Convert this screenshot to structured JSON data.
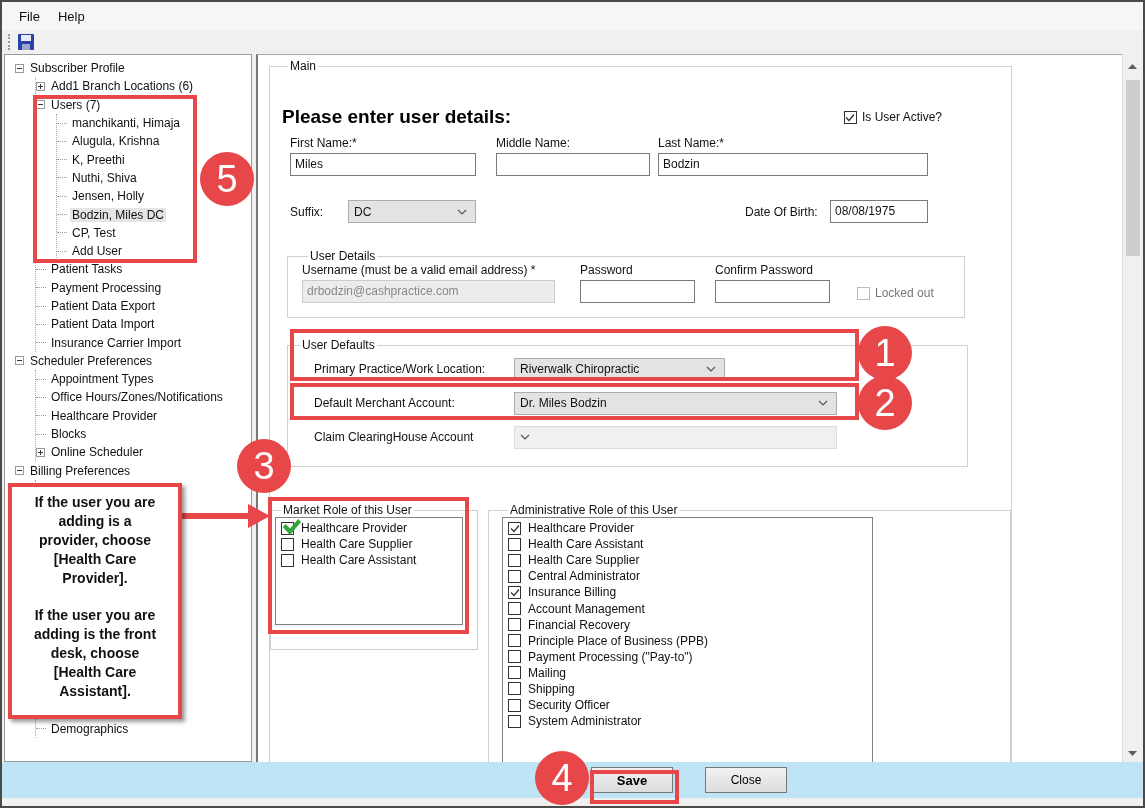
{
  "menu": [
    "File",
    "Help"
  ],
  "tree": [
    {
      "label": "Subscriber Profile",
      "expanded": true,
      "selected": false,
      "children": [
        {
          "label": "Add1 Branch Locations (6)",
          "expanded": false,
          "selected": false
        },
        {
          "label": "Users (7)",
          "expanded": true,
          "selected": false,
          "children": [
            {
              "label": "manchikanti, Himaja",
              "selected": false
            },
            {
              "label": "Alugula, Krishna",
              "selected": false
            },
            {
              "label": "K, Preethi",
              "selected": false
            },
            {
              "label": "Nuthi, Shiva",
              "selected": false
            },
            {
              "label": "Jensen, Holly",
              "selected": false
            },
            {
              "label": "Bodzin, Miles DC",
              "selected": true
            },
            {
              "label": "CP, Test",
              "selected": false
            },
            {
              "label": "Add User",
              "selected": false
            }
          ]
        },
        {
          "label": "Patient Tasks",
          "selected": false
        },
        {
          "label": "Payment Processing",
          "selected": false
        },
        {
          "label": "Patient Data Export",
          "selected": false
        },
        {
          "label": "Patient Data Import",
          "selected": false
        },
        {
          "label": "Insurance Carrier Import",
          "selected": false
        }
      ]
    },
    {
      "label": "Scheduler Preferences",
      "expanded": true,
      "selected": false,
      "children": [
        {
          "label": "Appointment Types",
          "selected": false
        },
        {
          "label": "Office Hours/Zones/Notifications",
          "selected": false
        },
        {
          "label": "Healthcare Provider",
          "selected": false
        },
        {
          "label": "Blocks",
          "selected": false
        },
        {
          "label": "Online Scheduler",
          "expanded": false,
          "selected": false
        }
      ]
    },
    {
      "label": "Billing Preferences",
      "expanded": true,
      "selected": false,
      "children": [
        {
          "label": "Demographics",
          "selected": false
        }
      ]
    }
  ],
  "main": {
    "legend": "Main",
    "heading": "Please enter user details:",
    "active": {
      "label": "Is User Active?",
      "checked": true
    },
    "names": [
      {
        "label": "First Name:*",
        "value": "Miles"
      },
      {
        "label": "Middle Name:"
      },
      {
        "label": "Last Name:*",
        "value": "Bodzin"
      }
    ],
    "suffix": {
      "label": "Suffix:",
      "value": "DC"
    },
    "dob": {
      "label": "Date Of Birth:",
      "value": "08/08/1975"
    },
    "user_details": {
      "legend": "User Details",
      "username": {
        "label": "Username (must be a valid email address) *",
        "value": "drbodzin@cashpractice.com",
        "disabled": true
      },
      "password": {
        "label": "Password"
      },
      "confirm": {
        "label": "Confirm Password"
      },
      "locked": {
        "label": "Locked out",
        "checked": false,
        "disabled": true
      }
    },
    "user_defaults": {
      "legend": "User Defaults",
      "rows": [
        {
          "label": "Primary Practice/Work Location:",
          "value": "Riverwalk Chiropractic",
          "disabled": false
        },
        {
          "label": "Default Merchant Account:",
          "value": "Dr. Miles Bodzin",
          "disabled": false
        },
        {
          "label": "Claim ClearingHouse Account",
          "disabled": true
        }
      ]
    },
    "market_role": {
      "legend": "Market Role of this User",
      "items": [
        {
          "label": "Healthcare Provider",
          "checked": true
        },
        {
          "label": "Health Care Supplier",
          "checked": false
        },
        {
          "label": "Health Care Assistant",
          "checked": false
        }
      ]
    },
    "admin_role": {
      "legend": "Administrative Role of this User",
      "items": [
        {
          "label": "Healthcare Provider",
          "checked": true
        },
        {
          "label": "Health Care Assistant",
          "checked": false
        },
        {
          "label": "Health Care Supplier",
          "checked": false
        },
        {
          "label": "Central Administrator",
          "checked": false
        },
        {
          "label": "Insurance Billing",
          "checked": true
        },
        {
          "label": "Account Management",
          "checked": false
        },
        {
          "label": "Financial Recovery",
          "checked": false
        },
        {
          "label": "Principle Place of Business (PPB)",
          "checked": false
        },
        {
          "label": "Payment Processing (\"Pay-to\")",
          "checked": false
        },
        {
          "label": "Mailing",
          "checked": false
        },
        {
          "label": "Shipping",
          "checked": false
        },
        {
          "label": "Security Officer",
          "checked": false
        },
        {
          "label": "System Administrator",
          "checked": false
        }
      ]
    }
  },
  "buttons": [
    {
      "label": "Save"
    },
    {
      "label": "Close"
    }
  ],
  "annotations": {
    "badges": [
      "5",
      "1",
      "2",
      "3",
      "4"
    ],
    "callout": [
      "If the user you are adding is a provider, choose [Health Care Provider].",
      "If the user you are adding is the front desk, choose [Health Care Assistant]."
    ]
  }
}
